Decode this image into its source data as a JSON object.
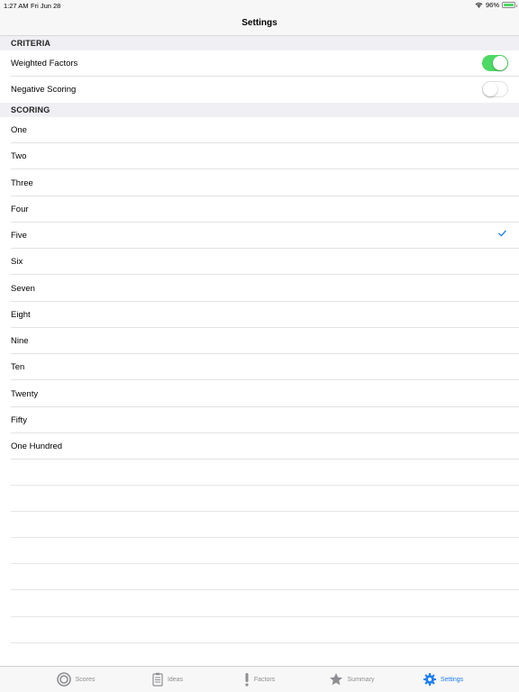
{
  "status_bar": {
    "time": "1:27 AM",
    "date": "Fri Jun 28",
    "battery": "96%",
    "battery_level": 0.96
  },
  "nav": {
    "title": "Settings"
  },
  "criteria": {
    "header": "CRITERIA",
    "items": [
      {
        "label": "Weighted Factors",
        "on": true
      },
      {
        "label": "Negative Scoring",
        "on": false
      }
    ]
  },
  "scoring": {
    "header": "SCORING",
    "items": [
      {
        "label": "One"
      },
      {
        "label": "Two"
      },
      {
        "label": "Three"
      },
      {
        "label": "Four"
      },
      {
        "label": "Five",
        "selected": true
      },
      {
        "label": "Six"
      },
      {
        "label": "Seven"
      },
      {
        "label": "Eight"
      },
      {
        "label": "Nine"
      },
      {
        "label": "Ten"
      },
      {
        "label": "Twenty"
      },
      {
        "label": "Fifty"
      },
      {
        "label": "One Hundred"
      }
    ]
  },
  "tabs": [
    {
      "label": "Scores",
      "icon": "target-icon"
    },
    {
      "label": "Ideas",
      "icon": "clipboard-icon"
    },
    {
      "label": "Factors",
      "icon": "exclamation-icon"
    },
    {
      "label": "Summary",
      "icon": "star-icon"
    },
    {
      "label": "Settings",
      "icon": "gear-icon",
      "active": true
    }
  ],
  "colors": {
    "accent": "#1e7ef2",
    "toggle_on": "#4cd964",
    "inactive": "#8e8e93"
  }
}
